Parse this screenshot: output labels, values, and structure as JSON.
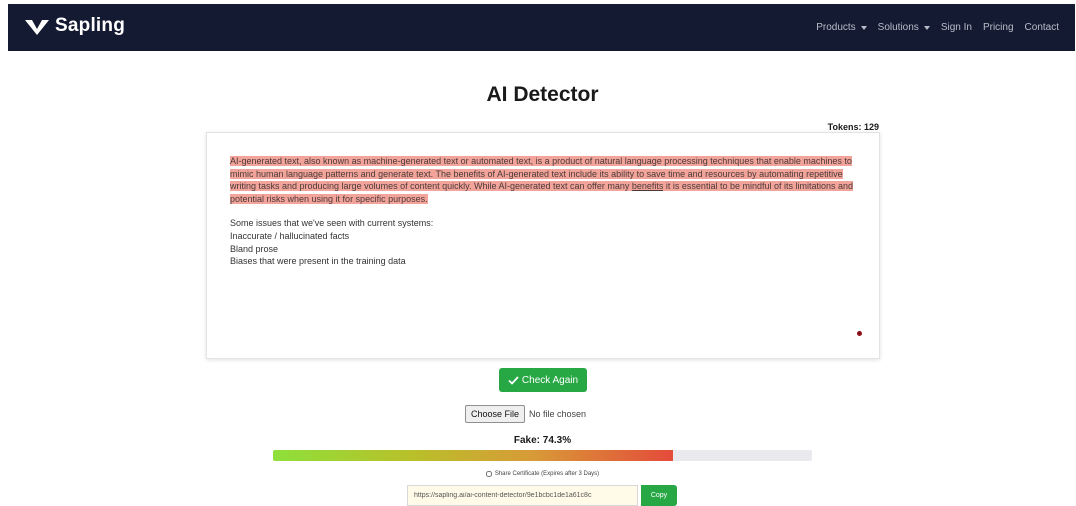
{
  "nav": {
    "brand": "Sapling",
    "links": {
      "products": "Products",
      "solutions": "Solutions",
      "signin": "Sign In",
      "pricing": "Pricing",
      "contact": "Contact"
    }
  },
  "main": {
    "title": "AI Detector",
    "tokens": "Tokens: 129",
    "editor": {
      "highlighted_1": "AI-generated text, also known as machine-generated text or automated text, is a product of natural language processing techniques that enable machines to mimic human language patterns and generate text. The benefits of AI-generated text include its ability to save time and resources by automating repetitive writing tasks and producing large volumes of content quickly. While AI-generated text can offer many ",
      "highlighted_underlined": "benefits",
      "highlighted_2": " it is essential to be mindful of its limitations and potential risks when using it for specific purposes.",
      "lines": [
        "Some issues that we've seen with current systems:",
        "Inaccurate / hallucinated facts",
        "Bland prose",
        "Biases that were present in the training data"
      ]
    },
    "check_button": "Check Again",
    "file": {
      "button": "Choose File",
      "status": "No file chosen"
    },
    "result": {
      "label": "Fake: 74.3%",
      "fake_fraction": 0.743
    },
    "share": {
      "label": "Share Certificate (Expires after 3 Days)",
      "checked": false
    },
    "url": {
      "value": "https://sapling.ai/ai-content-detector/9e1bcbc1de1a61c8c",
      "copy": "Copy"
    }
  },
  "colors": {
    "navbar": "#151a33",
    "highlight": "#f2a49b",
    "accent_green": "#28a745",
    "marker": "#8a0f18"
  },
  "icons": {
    "brand": "sapling-logo-icon",
    "check": "check-icon",
    "dropdown": "caret-down-icon"
  }
}
